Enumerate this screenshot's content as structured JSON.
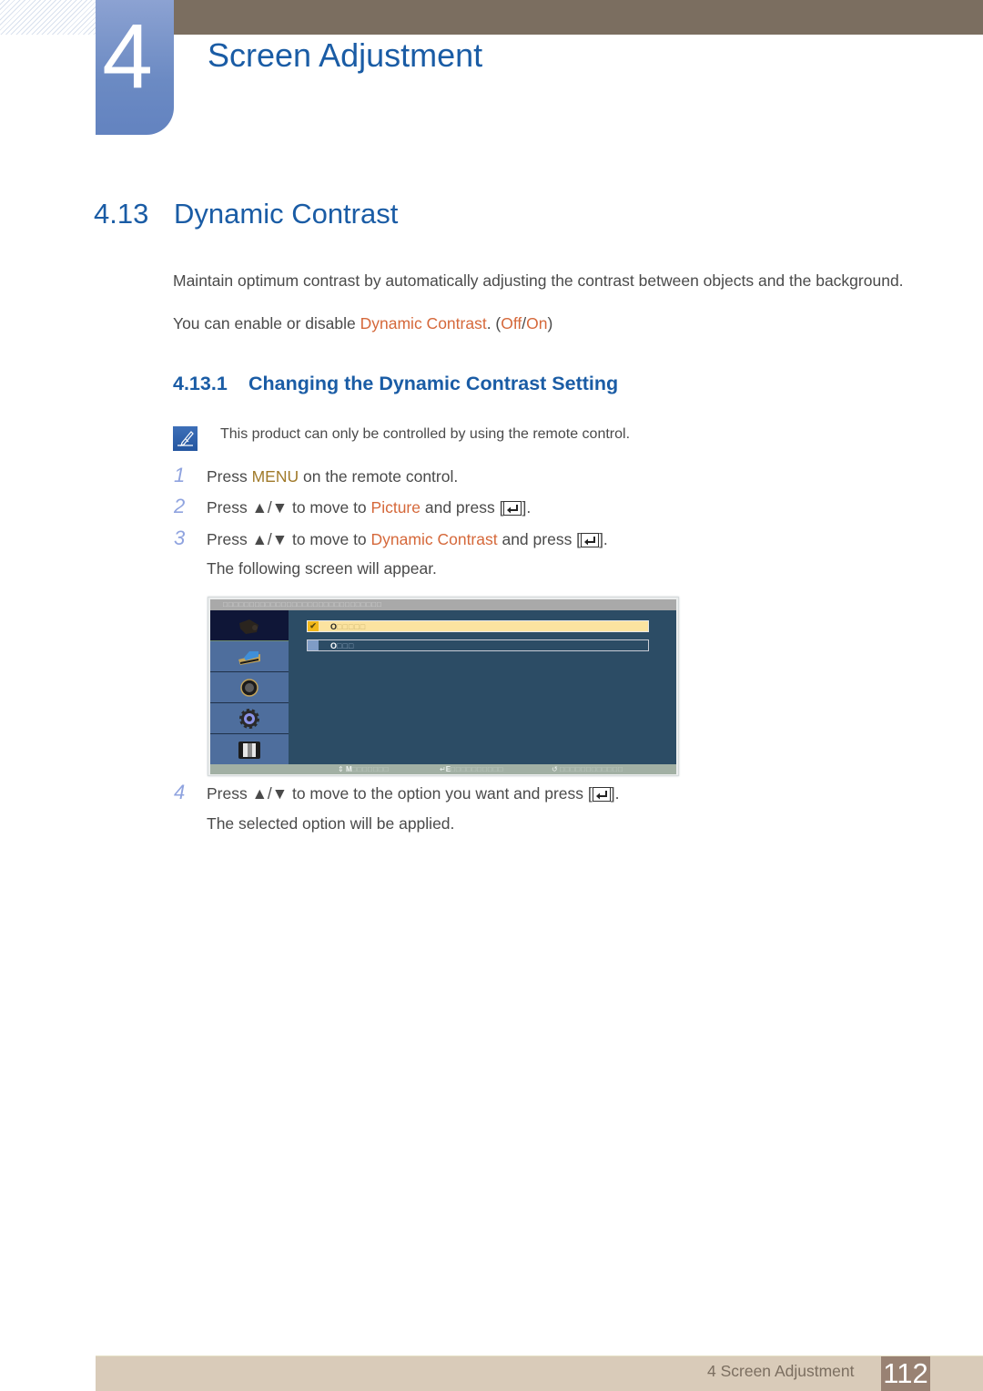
{
  "header": {
    "chapter_number": "4",
    "chapter_title": "Screen Adjustment"
  },
  "section": {
    "number": "4.13",
    "title": "Dynamic Contrast",
    "intro": "Maintain optimum contrast by automatically adjusting the contrast between objects and the background.",
    "enable_text_before": "You can enable or disable ",
    "enable_highlight": "Dynamic Contrast",
    "enable_text_mid": ". (",
    "option_off": "Off",
    "option_sep": "/",
    "option_on": "On",
    "enable_text_end": ")"
  },
  "subsection": {
    "number": "4.13.1",
    "title": "Changing the Dynamic Contrast Setting",
    "note": "This product can only be controlled by using the remote control."
  },
  "steps": [
    {
      "num": "1",
      "pre": "Press ",
      "hl": "MENU",
      "post": " on the remote control.",
      "enter": false
    },
    {
      "num": "2",
      "pre": "Press ▲/▼ to move to ",
      "hl": "Picture",
      "post": " and press [",
      "enter": true,
      "end": "]."
    },
    {
      "num": "3",
      "pre": "Press ▲/▼ to move to ",
      "hl": "Dynamic Contrast",
      "post": " and press [",
      "enter": true,
      "end": "].",
      "followup": "The following screen will appear."
    },
    {
      "num": "4",
      "pre": "Press ▲/▼ to move to the option you want and press [",
      "enter": true,
      "end": "].",
      "followup": "The selected option will be applied."
    }
  ],
  "osd": {
    "title_glyphs": "□□□□□□□□□□□□□□□□□□□□□□□□□□□□□□",
    "menu_icons": [
      "picture-icon",
      "color-icon",
      "image-icon",
      "setup-icon",
      "information-icon"
    ],
    "options": [
      {
        "mark": "✔",
        "first": "O",
        "rest": "□□□□□",
        "selected": true
      },
      {
        "mark": "",
        "first": "O",
        "rest": "□□□",
        "selected": false
      }
    ],
    "footer": [
      {
        "icon": "⇕",
        "first": "M",
        "rest": "□□□□□□□"
      },
      {
        "icon": "↵",
        "first": "E",
        "rest": "□□□□□□□□□□"
      },
      {
        "icon": "↺",
        "first": "",
        "rest": "□□□□□□□□□□□□"
      }
    ]
  },
  "footer": {
    "chapter_label": "4 Screen Adjustment",
    "page_number": "112"
  }
}
